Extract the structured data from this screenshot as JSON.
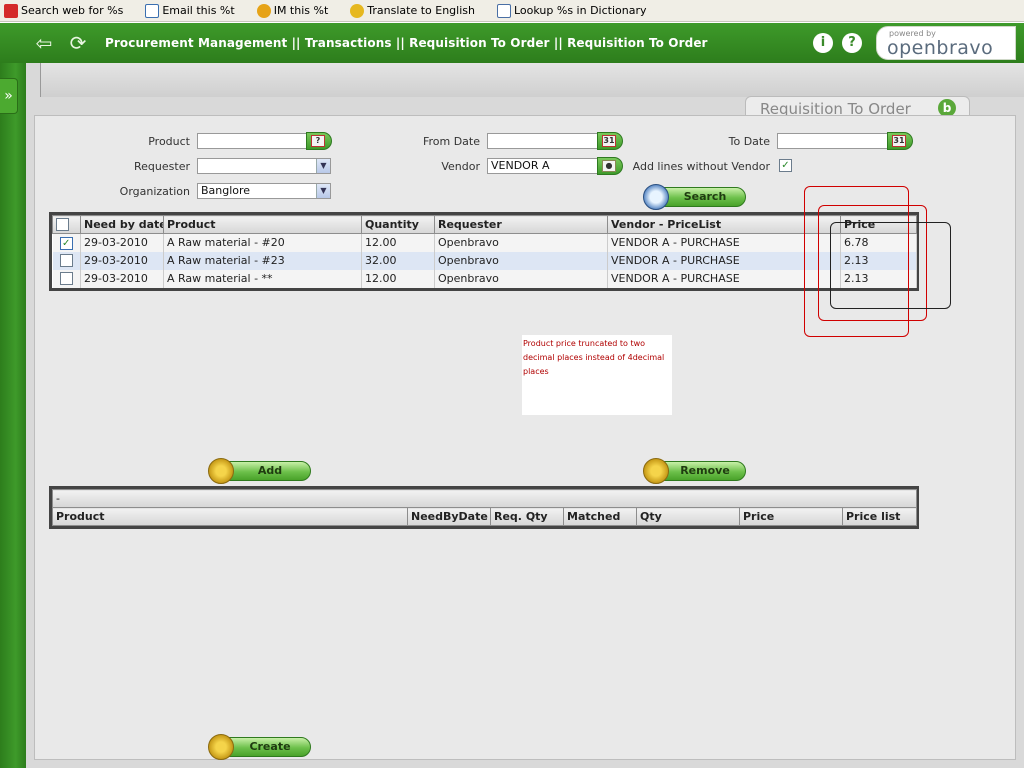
{
  "browser_toolbar": {
    "items": [
      {
        "label": "Search web for %s",
        "icon": "yahoo-icon",
        "color": "#d42a2a"
      },
      {
        "label": "Email this %t",
        "icon": "envelope-icon",
        "color": "#3a6fb0"
      },
      {
        "label": "IM this %t",
        "icon": "smiley-icon",
        "color": "#e6a317"
      },
      {
        "label": "Translate to English",
        "icon": "translate-icon",
        "color": "#e6b820"
      },
      {
        "label": "Lookup %s in Dictionary",
        "icon": "dictionary-icon",
        "color": "#4a6fa5"
      }
    ]
  },
  "app_header": {
    "breadcrumb": "Procurement Management || Transactions || Requisition To Order  ||  Requisition To Order",
    "back_icon": "back-arrow-icon",
    "refresh_icon": "refresh-icon",
    "info_glyph": "i",
    "help_glyph": "?",
    "logo_powered": "powered by",
    "logo_name": "openbravo"
  },
  "tab": {
    "title": "Requisition To Order",
    "badge": "b"
  },
  "filters": {
    "product_label": "Product",
    "product_value": "",
    "requester_label": "Requester",
    "requester_value": "",
    "organization_label": "Organization",
    "organization_value": "Banglore",
    "from_date_label": "From Date",
    "from_date_value": "",
    "vendor_label": "Vendor",
    "vendor_value": "VENDOR A",
    "to_date_label": "To Date",
    "to_date_value": "",
    "add_lines_label": "Add lines without Vendor",
    "add_lines_checked": true,
    "calendar_glyph": "31",
    "search_label": "Search"
  },
  "requisition_grid": {
    "columns": [
      "Need by date",
      "Product",
      "Quantity",
      "Requester",
      "Vendor - PriceList",
      "Price"
    ],
    "rows": [
      {
        "checked": true,
        "need_by_date": "29-03-2010",
        "product": "A Raw material - #20",
        "quantity": "12.00",
        "requester": "Openbravo",
        "vendor_pricelist": "VENDOR A - PURCHASE",
        "price": "6.78"
      },
      {
        "checked": false,
        "need_by_date": "29-03-2010",
        "product": "A Raw material - #23",
        "quantity": "32.00",
        "requester": "Openbravo",
        "vendor_pricelist": "VENDOR A - PURCHASE",
        "price": "2.13"
      },
      {
        "checked": false,
        "need_by_date": "29-03-2010",
        "product": "A Raw material - **",
        "quantity": "12.00",
        "requester": "Openbravo",
        "vendor_pricelist": "VENDOR A - PURCHASE",
        "price": "2.13"
      }
    ]
  },
  "annotation": {
    "text": "Product price truncated to two decimal places instead of 4decimal places",
    "color": "#b00000"
  },
  "actions": {
    "add_label": "Add",
    "remove_label": "Remove",
    "create_label": "Create"
  },
  "selected_grid": {
    "group_row": "-",
    "columns": [
      "Product",
      "NeedByDate",
      "Req. Qty",
      "Matched",
      "Qty",
      "Price",
      "Price list"
    ]
  },
  "colors": {
    "header_green": "#3e9a2a",
    "workspace_grey": "#d9d9d9",
    "panel_grey": "#e9e9e9",
    "highlight_red": "#d00000"
  }
}
